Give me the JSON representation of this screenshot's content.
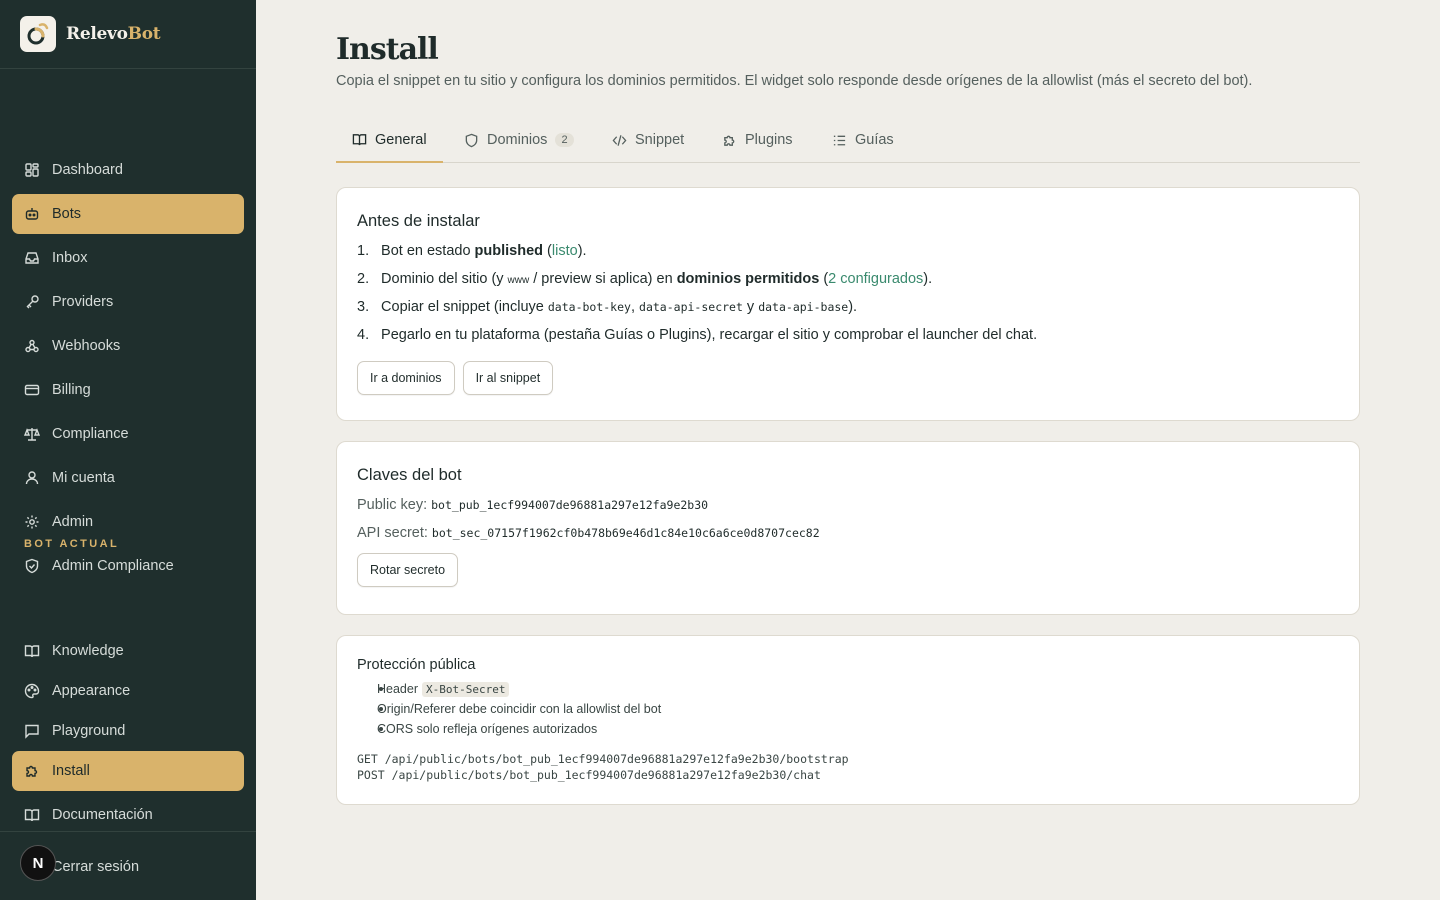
{
  "brand": {
    "name_a": "Relevo",
    "name_b": "Bot"
  },
  "sidebar": {
    "items": [
      {
        "label": "Dashboard",
        "icon": "grid-icon"
      },
      {
        "label": "Bots",
        "icon": "bot-icon",
        "active": true
      },
      {
        "label": "Inbox",
        "icon": "inbox-icon"
      },
      {
        "label": "Providers",
        "icon": "key-icon"
      },
      {
        "label": "Webhooks",
        "icon": "webhook-icon"
      },
      {
        "label": "Billing",
        "icon": "credit-card-icon"
      },
      {
        "label": "Compliance",
        "icon": "scale-icon"
      },
      {
        "label": "Mi cuenta",
        "icon": "user-icon"
      },
      {
        "label": "Admin",
        "icon": "gear-icon"
      },
      {
        "label": "Admin Compliance",
        "icon": "shield-check-icon"
      }
    ],
    "section_label": "BOT ACTUAL",
    "bot_items": [
      {
        "label": "Knowledge",
        "icon": "book-icon"
      },
      {
        "label": "Appearance",
        "icon": "palette-icon"
      },
      {
        "label": "Playground",
        "icon": "message-icon"
      },
      {
        "label": "Install",
        "icon": "puzzle-icon",
        "active": true
      },
      {
        "label": "Documentación",
        "icon": "book-icon"
      }
    ],
    "logout": "Cerrar sesión",
    "avatar_letter": "N"
  },
  "page": {
    "title": "Install",
    "subtitle": "Copia el snippet en tu sitio y configura los dominios permitidos. El widget solo responde desde orígenes de la allowlist (más el secreto del bot)."
  },
  "tabs": [
    {
      "label": "General",
      "icon": "book-open-icon",
      "active": true
    },
    {
      "label": "Dominios",
      "icon": "shield-icon",
      "count": "2"
    },
    {
      "label": "Snippet",
      "icon": "code-icon"
    },
    {
      "label": "Plugins",
      "icon": "puzzle-icon"
    },
    {
      "label": "Guías",
      "icon": "list-icon"
    }
  ],
  "before_install": {
    "title": "Antes de instalar",
    "step1": {
      "num": "1.",
      "a": "Bot en estado ",
      "b": "published",
      "c": " (",
      "link": "listo",
      "d": ")."
    },
    "step2": {
      "num": "2.",
      "a": "Dominio del sitio (y ",
      "www": "www",
      "b": " / preview si aplica) en ",
      "c": "dominios permitidos",
      "d": " (",
      "link": "2 configurados",
      "e": ")."
    },
    "step3": {
      "num": "3.",
      "a": "Copiar el snippet (incluye ",
      "code1": "data-bot-key",
      "b": ", ",
      "code2": "data-api-secret",
      "c": " y ",
      "code3": "data-api-base",
      "d": ")."
    },
    "step4": {
      "num": "4.",
      "text": "Pegarlo en tu plataforma (pestaña Guías o Plugins), recargar el sitio y comprobar el launcher del chat."
    },
    "btn_domains": "Ir a dominios",
    "btn_snippet": "Ir al snippet"
  },
  "keys": {
    "title": "Claves del bot",
    "public_label": "Public key:",
    "public_value": "bot_pub_1ecf994007de96881a297e12fa9e2b30",
    "secret_label": "API secret:",
    "secret_value": "bot_sec_07157f1962cf0b478b69e46d1c84e10c6a6ce0d8707cec82",
    "rotate_btn": "Rotar secreto"
  },
  "protection": {
    "title": "Protección pública",
    "bullet1": "Header",
    "bullet1_code": "X-Bot-Secret",
    "bullet2": "Origin/Referer debe coincidir con la allowlist del bot",
    "bullet3": "CORS solo refleja orígenes autorizados",
    "endpoint1": "GET /api/public/bots/bot_pub_1ecf994007de96881a297e12fa9e2b30/bootstrap",
    "endpoint2": "POST /api/public/bots/bot_pub_1ecf994007de96881a297e12fa9e2b30/chat"
  }
}
